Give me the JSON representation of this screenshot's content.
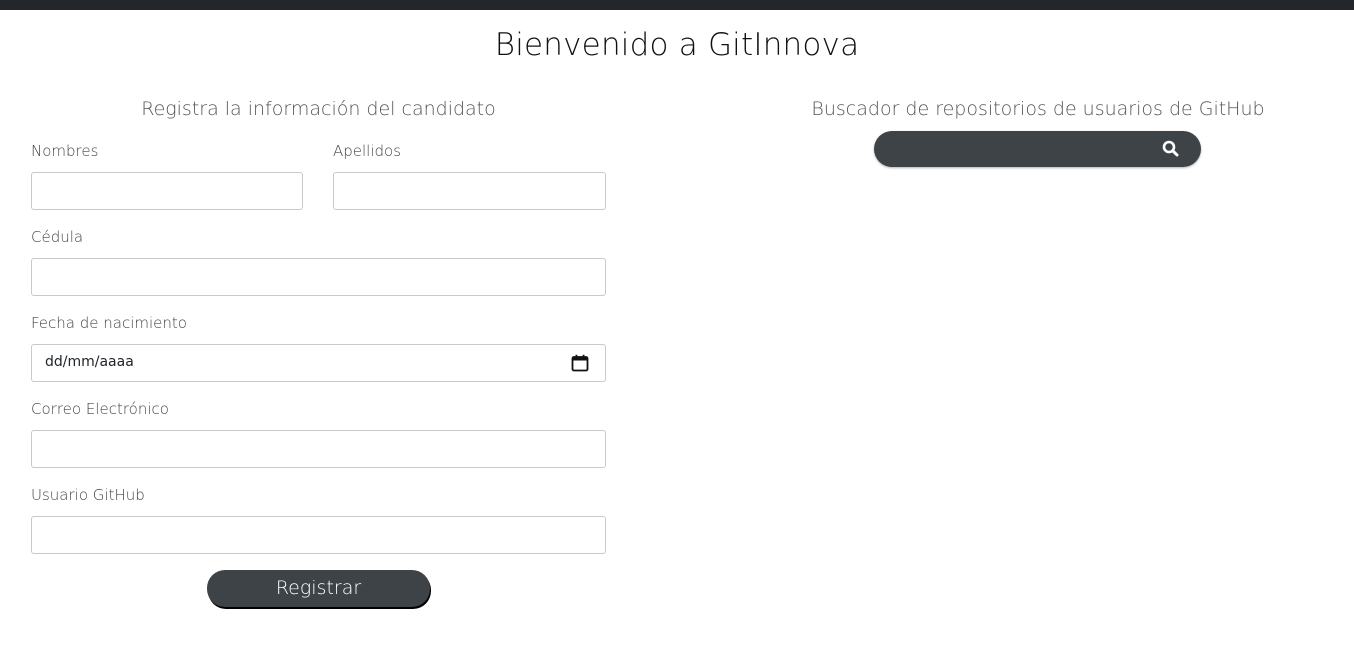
{
  "header": {
    "title": "Bienvenido a GitInnova"
  },
  "form": {
    "title": "Registra la información del candidato",
    "fields": {
      "nombres": {
        "label": "Nombres",
        "value": ""
      },
      "apellidos": {
        "label": "Apellidos",
        "value": ""
      },
      "cedula": {
        "label": "Cédula",
        "value": ""
      },
      "fecha_nacimiento": {
        "label": "Fecha de nacimiento",
        "value": "dd/mm/aaaa"
      },
      "correo": {
        "label": "Correo Electrónico",
        "value": ""
      },
      "usuario_github": {
        "label": "Usuario GitHub",
        "value": ""
      }
    },
    "submit_label": "Registrar"
  },
  "search": {
    "title": "Buscador de repositorios de usuarios de GitHub",
    "value": "",
    "icon": "search-icon"
  },
  "colors": {
    "topbar": "#23272b",
    "button_bg": "#3e4347",
    "button_text": "#ffffff"
  }
}
